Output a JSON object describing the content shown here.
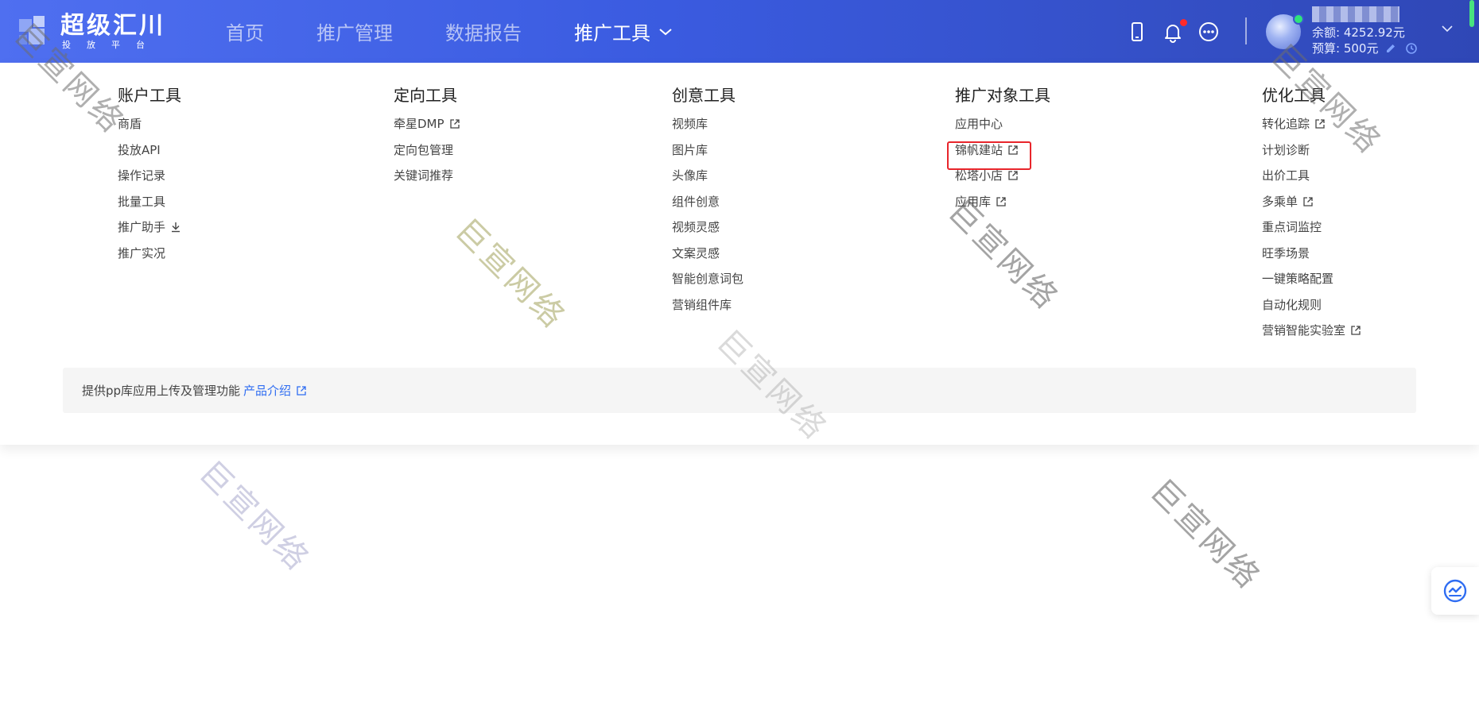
{
  "logo": {
    "title": "超级汇川",
    "subtitle": "投放平台"
  },
  "nav": {
    "items": [
      "首页",
      "推广管理",
      "数据报告"
    ],
    "active": "推广工具"
  },
  "header": {
    "balance": "余额: 4252.92元",
    "budget": "预算: 500元"
  },
  "menu": {
    "columns": [
      {
        "title": "账户工具",
        "items": [
          {
            "label": "商盾",
            "icon": ""
          },
          {
            "label": "投放API",
            "icon": ""
          },
          {
            "label": "操作记录",
            "icon": ""
          },
          {
            "label": "批量工具",
            "icon": ""
          },
          {
            "label": "推广助手",
            "icon": "download-icon"
          },
          {
            "label": "推广实况",
            "icon": ""
          }
        ]
      },
      {
        "title": "定向工具",
        "items": [
          {
            "label": "牵星DMP",
            "icon": "external-link-icon"
          },
          {
            "label": "定向包管理",
            "icon": ""
          },
          {
            "label": "关键词推荐",
            "icon": ""
          }
        ]
      },
      {
        "title": "创意工具",
        "items": [
          {
            "label": "视频库",
            "icon": ""
          },
          {
            "label": "图片库",
            "icon": ""
          },
          {
            "label": "头像库",
            "icon": ""
          },
          {
            "label": "组件创意",
            "icon": ""
          },
          {
            "label": "视频灵感",
            "icon": ""
          },
          {
            "label": "文案灵感",
            "icon": ""
          },
          {
            "label": "智能创意词包",
            "icon": ""
          },
          {
            "label": "营销组件库",
            "icon": ""
          }
        ]
      },
      {
        "title": "推广对象工具",
        "items": [
          {
            "label": "应用中心",
            "icon": ""
          },
          {
            "label": "锦帆建站",
            "icon": "external-link-icon"
          },
          {
            "label": "松塔小店",
            "icon": "external-link-icon"
          },
          {
            "label": "应用库",
            "icon": "external-link-icon"
          }
        ]
      },
      {
        "title": "优化工具",
        "items": [
          {
            "label": "转化追踪",
            "icon": "external-link-icon"
          },
          {
            "label": "计划诊断",
            "icon": ""
          },
          {
            "label": "出价工具",
            "icon": ""
          },
          {
            "label": "多乘单",
            "icon": "external-link-icon"
          },
          {
            "label": "重点词监控",
            "icon": ""
          },
          {
            "label": "旺季场景",
            "icon": ""
          },
          {
            "label": "一键策略配置",
            "icon": ""
          },
          {
            "label": "自动化规则",
            "icon": ""
          },
          {
            "label": "营销智能实验室",
            "icon": "external-link-icon"
          }
        ]
      }
    ],
    "info": {
      "text": "提供pp库应用上传及管理功能",
      "link": "产品介绍"
    }
  },
  "watermark": {
    "text": "巨宣网络"
  },
  "colors": {
    "accent": "#2f6df2",
    "highlight": "#e8252b",
    "header": "#3a5be0"
  }
}
